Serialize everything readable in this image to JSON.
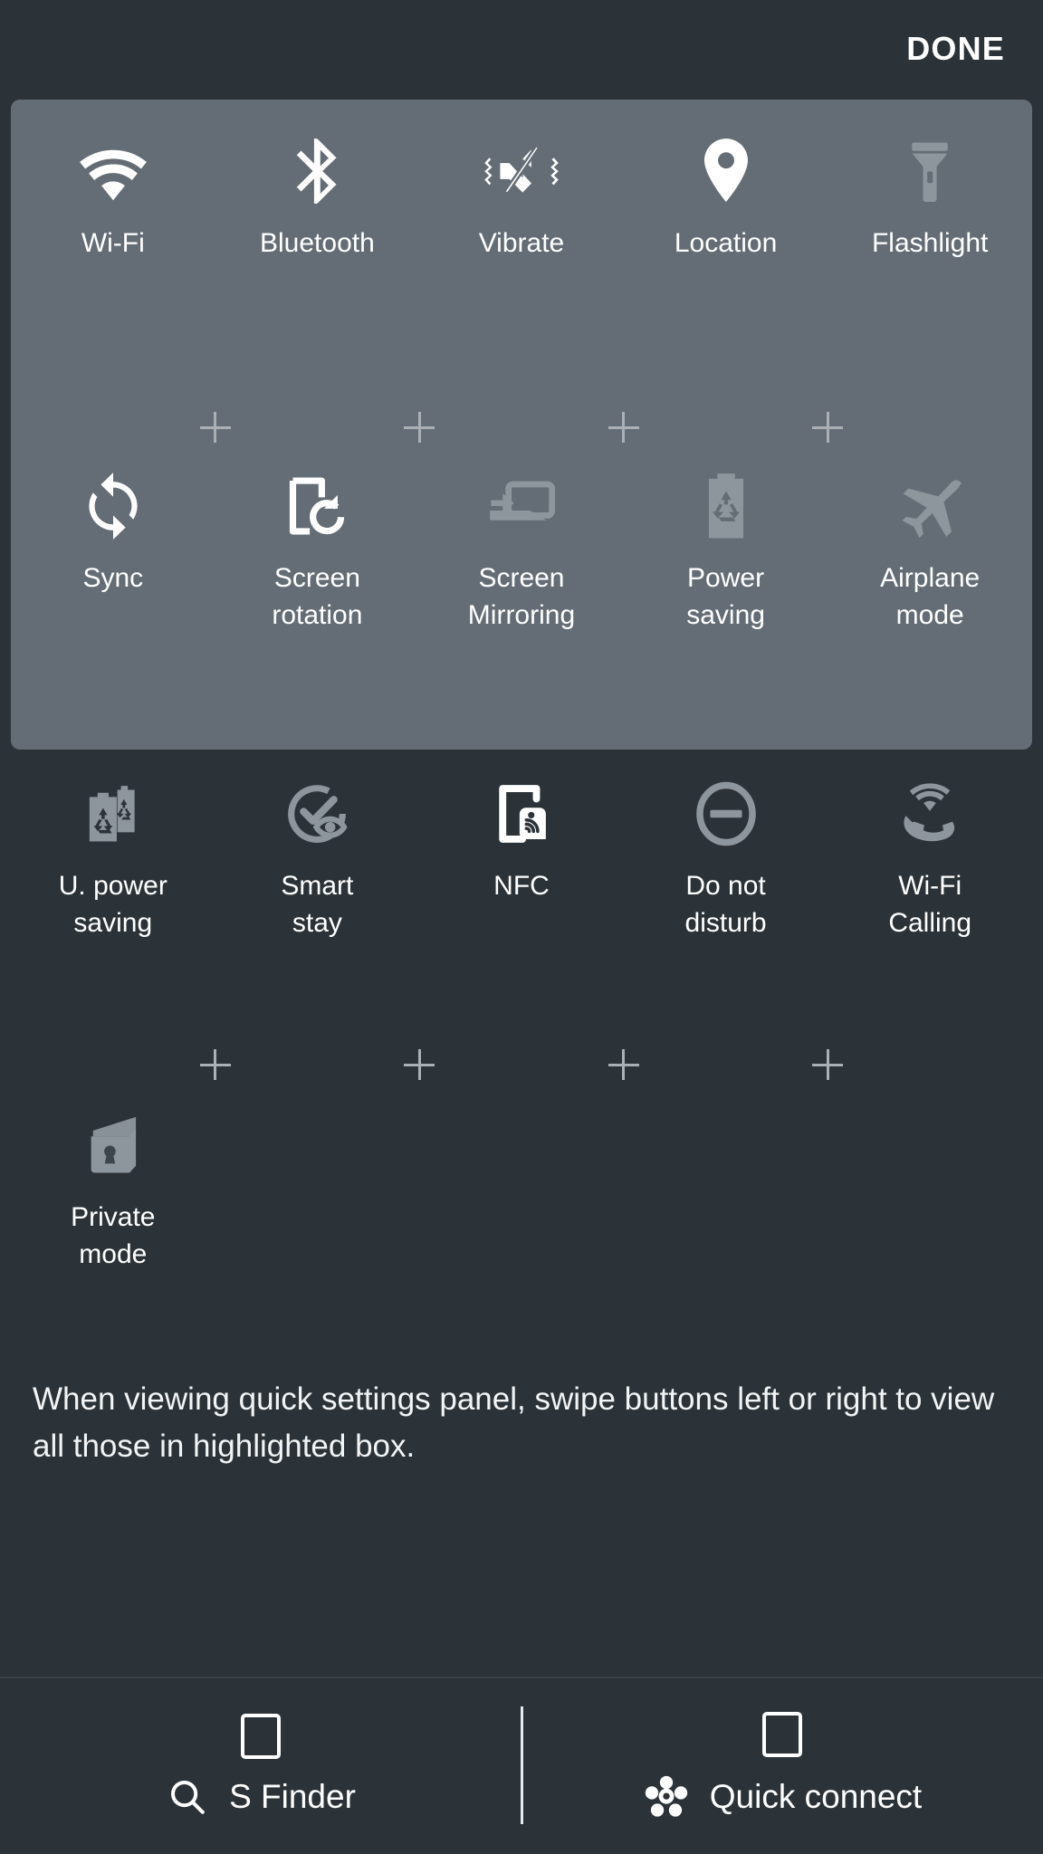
{
  "header": {
    "done_label": "DONE"
  },
  "colors": {
    "background": "#2b3338",
    "panel": "#646d75",
    "active_icon": "#ffffff",
    "inactive_icon": "#8d969d",
    "label": "#ffffff",
    "plus": "#aab0b5"
  },
  "highlighted_panel": {
    "rows": [
      {
        "tiles": [
          {
            "label": "Wi-Fi",
            "icon": "wifi-icon",
            "state": "active"
          },
          {
            "label": "Bluetooth",
            "icon": "bluetooth-icon",
            "state": "active"
          },
          {
            "label": "Vibrate",
            "icon": "vibrate-icon",
            "state": "active"
          },
          {
            "label": "Location",
            "icon": "location-pin-icon",
            "state": "active"
          },
          {
            "label": "Flashlight",
            "icon": "flashlight-icon",
            "state": "inactive"
          }
        ]
      },
      {
        "tiles": [
          {
            "label": "Sync",
            "icon": "sync-icon",
            "state": "active"
          },
          {
            "label": "Screen\nrotation",
            "icon": "screen-rotation-icon",
            "state": "active"
          },
          {
            "label": "Screen\nMirroring",
            "icon": "screen-mirroring-icon",
            "state": "inactive"
          },
          {
            "label": "Power\nsaving",
            "icon": "power-saving-icon",
            "state": "inactive"
          },
          {
            "label": "Airplane\nmode",
            "icon": "airplane-icon",
            "state": "inactive"
          }
        ]
      }
    ],
    "separator_count": 4,
    "separator_symbol": "+"
  },
  "lower_grid": {
    "rows": [
      {
        "tiles": [
          {
            "label": "U. power\nsaving",
            "icon": "ultra-power-saving-icon",
            "state": "inactive"
          },
          {
            "label": "Smart\nstay",
            "icon": "smart-stay-icon",
            "state": "inactive"
          },
          {
            "label": "NFC",
            "icon": "nfc-icon",
            "state": "active"
          },
          {
            "label": "Do not\ndisturb",
            "icon": "do-not-disturb-icon",
            "state": "inactive"
          },
          {
            "label": "Wi-Fi\nCalling",
            "icon": "wifi-calling-icon",
            "state": "inactive"
          }
        ]
      },
      {
        "tiles": [
          {
            "label": "Private\nmode",
            "icon": "private-mode-icon",
            "state": "inactive"
          }
        ]
      }
    ],
    "separator_count": 4,
    "separator_symbol": "+"
  },
  "instruction": {
    "text": "When viewing quick settings panel, swipe buttons left or right to view all those in highlighted box."
  },
  "bottom_bar": {
    "items": [
      {
        "label": "S Finder",
        "icon": "search-icon",
        "checkbox": "unchecked"
      },
      {
        "label": "Quick connect",
        "icon": "quick-connect-icon",
        "checkbox": "unchecked"
      }
    ]
  }
}
